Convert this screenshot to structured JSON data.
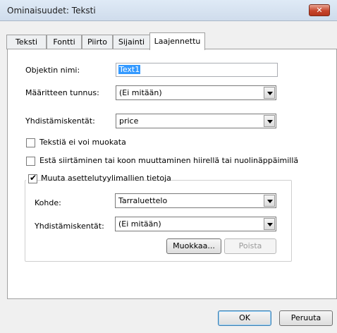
{
  "window": {
    "title": "Ominaisuudet: Teksti",
    "close_glyph": "✕"
  },
  "tabs": [
    {
      "label": "Teksti"
    },
    {
      "label": "Fontti"
    },
    {
      "label": "Piirto"
    },
    {
      "label": "Sijainti"
    },
    {
      "label": "Laajennettu"
    }
  ],
  "form": {
    "object_name_label": "Objektin nimi:",
    "object_name_value": "Text1",
    "attribute_id_label": "Määritteen tunnus:",
    "attribute_id_value": "(Ei mitään)",
    "merge_fields_label": "Yhdistämiskentät:",
    "merge_fields_value": "price",
    "no_edit_label": "Tekstiä ei voi muokata",
    "no_move_label": "Estä siirtäminen tai koon muuttaminen hiirellä tai nuolinäppäimillä"
  },
  "group": {
    "legend": "Muuta asettelutyylimallien tietoja",
    "target_label": "Kohde:",
    "target_value": "Tarraluettelo",
    "merge_label": "Yhdistämiskentät:",
    "merge_value": "(Ei mitään)",
    "edit_button": "Muokkaa...",
    "delete_button": "Poista"
  },
  "footer": {
    "ok_button": "OK",
    "cancel_button": "Peruuta"
  }
}
